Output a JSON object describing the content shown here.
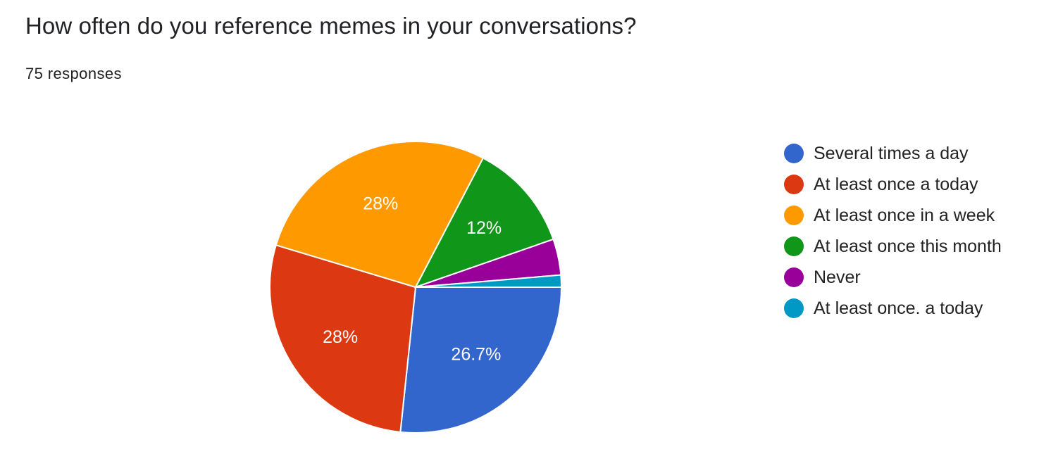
{
  "question": {
    "title": "How often do you reference memes in your conversations?",
    "responses": "75 responses"
  },
  "chart_data": {
    "type": "pie",
    "title": "How often do you reference memes in your conversations?",
    "total_responses": 75,
    "series": [
      {
        "name": "Several times a day",
        "value": 20,
        "percent": 26.7,
        "label": "26.7%",
        "color": "#3366cc"
      },
      {
        "name": "At least once a today",
        "value": 21,
        "percent": 28,
        "label": "28%",
        "color": "#dc3912"
      },
      {
        "name": "At least once in a week",
        "value": 21,
        "percent": 28,
        "label": "28%",
        "color": "#ff9900"
      },
      {
        "name": "At least once this month",
        "value": 9,
        "percent": 12,
        "label": "12%",
        "color": "#109618"
      },
      {
        "name": "Never",
        "value": 3,
        "percent": 4,
        "label": "",
        "color": "#990099"
      },
      {
        "name": "At least once. a today",
        "value": 1,
        "percent": 1.3,
        "label": "",
        "color": "#0099c6"
      }
    ],
    "legend_position": "right"
  }
}
